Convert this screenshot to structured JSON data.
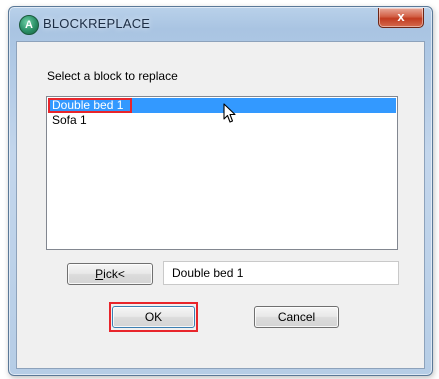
{
  "window": {
    "title": "BLOCKREPLACE",
    "app_icon": "autocad-logo-icon",
    "app_icon_glyph": "A",
    "close_glyph": "x"
  },
  "dialog": {
    "prompt": "Select a block to replace",
    "blocks": [
      "Double bed 1",
      "Sofa 1"
    ],
    "selected_block": "Double bed 1",
    "pick_button": {
      "underlined_char": "P",
      "rest": "ick<"
    },
    "selected_name_value": "Double bed 1",
    "ok_label": "OK",
    "cancel_label": "Cancel"
  },
  "colors": {
    "selection": "#3399ff",
    "annotation_red": "#e8252b",
    "close_red": "#c23b20"
  }
}
